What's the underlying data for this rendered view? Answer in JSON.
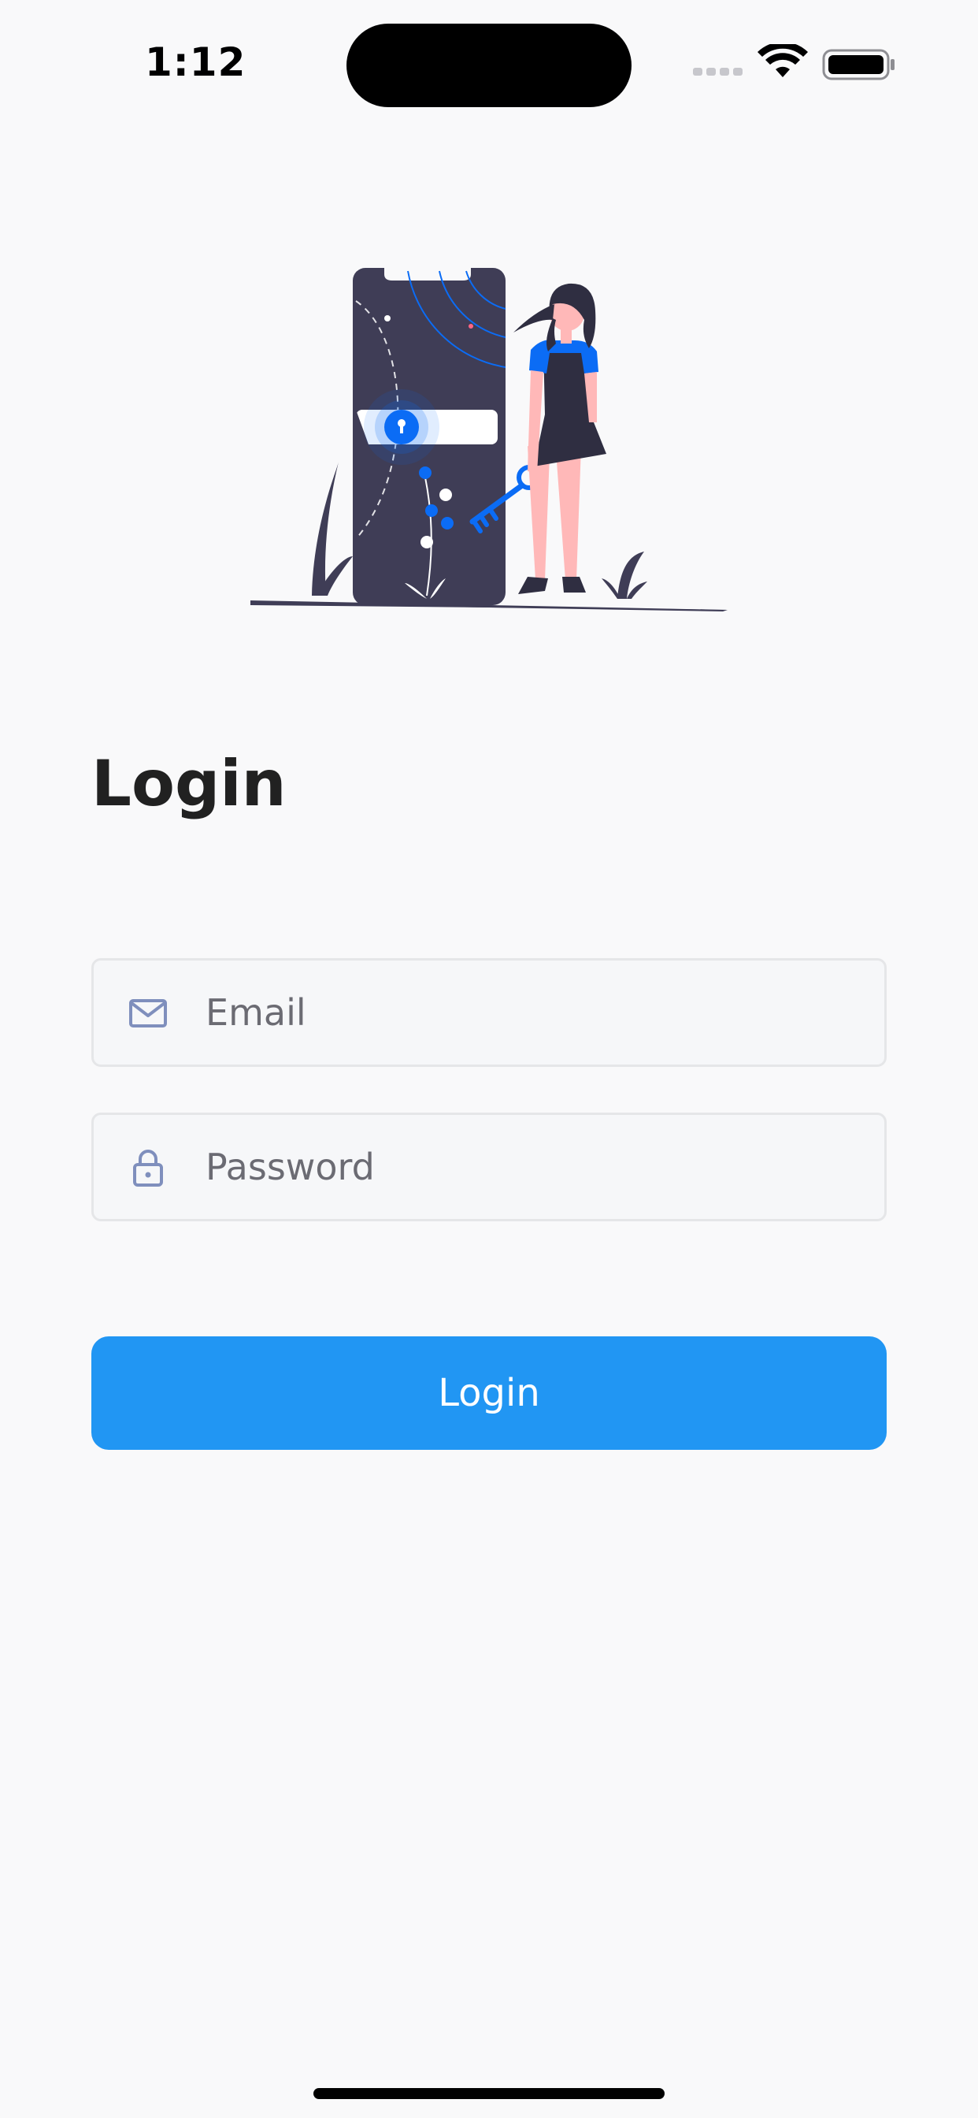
{
  "status_bar": {
    "time": "1:12",
    "icons": [
      "cellular-signal-icon",
      "wifi-icon",
      "battery-icon"
    ]
  },
  "illustration": {
    "name": "phone-lock-woman-with-key-illustration",
    "colors": {
      "dark": "#3f3d56",
      "accent": "#0b6cf5",
      "skin": "#ffb8b8"
    }
  },
  "login": {
    "title": "Login",
    "email": {
      "placeholder": "Email",
      "value": "",
      "icon": "mail-icon"
    },
    "password": {
      "placeholder": "Password",
      "value": "",
      "icon": "lock-icon"
    },
    "button_label": "Login"
  },
  "colors": {
    "background": "#f9f9fa",
    "button": "#2196f3",
    "field_background": "#f6f7f9",
    "field_border": "#e5e6e8",
    "icon": "#7f8fbd"
  }
}
